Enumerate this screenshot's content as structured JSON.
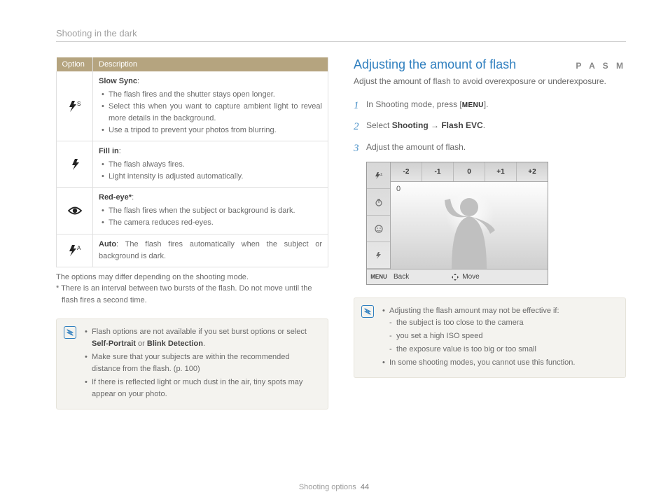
{
  "header": {
    "title": "Shooting in the dark"
  },
  "left": {
    "table": {
      "headers": {
        "option": "Option",
        "description": "Description"
      },
      "rows": [
        {
          "icon": "flash-slow",
          "title": "Slow Sync",
          "bullets": [
            "The flash fires and the shutter stays open longer.",
            "Select this when you want to capture ambient light to reveal more details in the background.",
            "Use a tripod to prevent your photos from blurring."
          ]
        },
        {
          "icon": "flash-fill",
          "title": "Fill in",
          "bullets": [
            "The flash always fires.",
            "Light intensity is adjusted automatically."
          ]
        },
        {
          "icon": "eye",
          "title": "Red-eye*",
          "bullets": [
            "The flash fires when the subject or background is dark.",
            "The camera reduces red-eyes."
          ]
        },
        {
          "icon": "flash-auto",
          "title": "Auto",
          "inline": ": The flash fires automatically when the subject or background is dark."
        }
      ]
    },
    "notes": {
      "line1": "The options may differ depending on the shooting mode.",
      "line2": "* There is an interval between two bursts of the flash. Do not move until the flash fires a second time."
    },
    "notebox": {
      "items": [
        {
          "pre": "Flash options are not available if you set burst options or select ",
          "b1": "Self-Portrait",
          "mid": " or ",
          "b2": "Blink Detection",
          "post": "."
        },
        {
          "text": "Make sure that your subjects are within the recommended distance from the flash. (p. 100)"
        },
        {
          "text": "If there is reflected light or much dust in the air, tiny spots may appear on your photo."
        }
      ]
    }
  },
  "right": {
    "heading": "Adjusting the amount of flash",
    "modes": "P A S M",
    "intro": "Adjust the amount of flash to avoid overexposure or underexposure.",
    "steps": [
      {
        "n": "1",
        "pre": "In Shooting mode, press [",
        "strong": "MENU",
        "post": "]."
      },
      {
        "n": "2",
        "pre": "Select ",
        "b1": "Shooting",
        "arrow": " → ",
        "b2": "Flash EVC",
        "post": "."
      },
      {
        "n": "3",
        "text": "Adjust the amount of flash."
      }
    ],
    "screen": {
      "scale": [
        "-2",
        "-1",
        "0",
        "+1",
        "+2"
      ],
      "readout": "0",
      "footer": {
        "menu": "MENU",
        "back": "Back",
        "move": "Move"
      }
    },
    "notebox": {
      "lead": "Adjusting the flash amount may not be effective if:",
      "subs": [
        "the subject is too close to the camera",
        "you set a high ISO speed",
        "the exposure value is too big or too small"
      ],
      "line2": "In some shooting modes, you cannot use this function."
    }
  },
  "footer": {
    "section": "Shooting options",
    "page": "44"
  }
}
